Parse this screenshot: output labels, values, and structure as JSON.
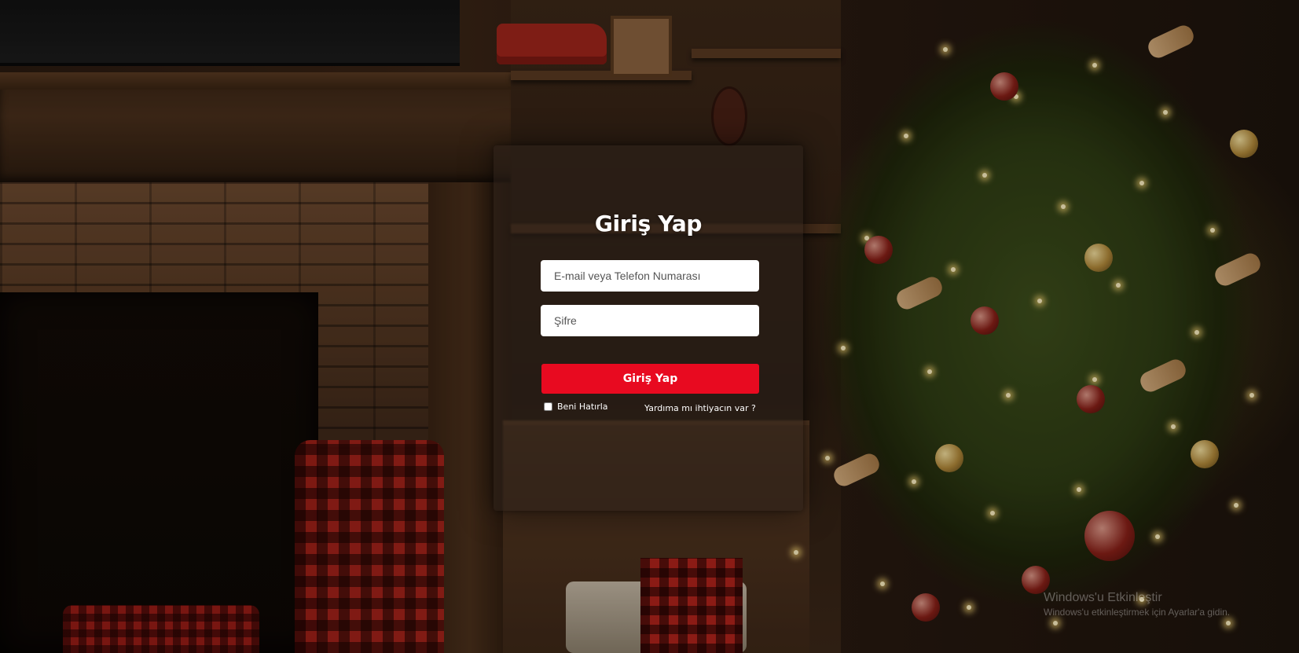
{
  "login": {
    "title": "Giriş Yap",
    "email_placeholder": "E-mail veya Telefon Numarası",
    "password_placeholder": "Şifre",
    "submit_label": "Giriş Yap",
    "remember_label": "Beni Hatırla",
    "help_link": "Yardıma mı ihtiyacın var ?"
  },
  "watermark": {
    "title": "Windows'u Etkinleştir",
    "subtitle": "Windows'u etkinleştirmek için Ayarlar'a gidin."
  },
  "colors": {
    "primary_button": "#e80a20",
    "card_overlay": "rgba(42,32,26,0.50)",
    "text": "#ffffff"
  },
  "background": {
    "icon": "christmas-living-room-photo"
  }
}
